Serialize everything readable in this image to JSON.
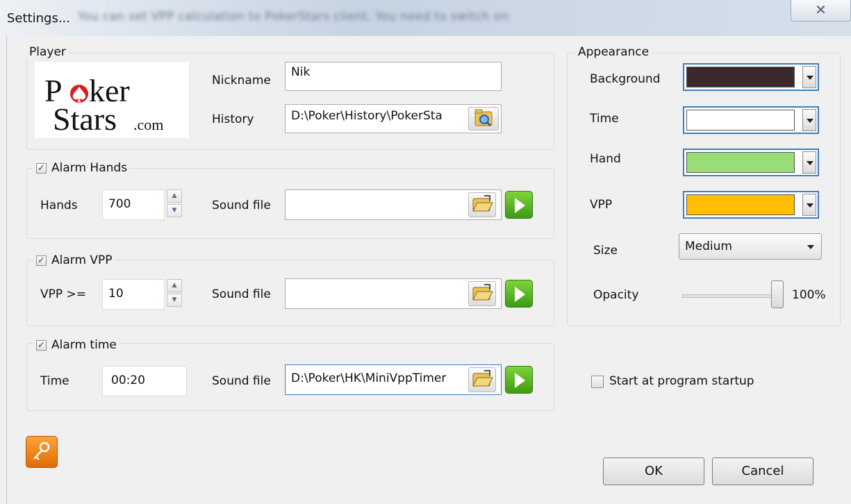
{
  "window": {
    "title": "Settings...",
    "background_text": "You can set VPP calculation to PokerStars client. You need to switch on",
    "close_glyph": "✕"
  },
  "logo": {
    "brand": "PokerStars.com",
    "line1_a": "P",
    "line1_b": "ker",
    "line2_a": "Stars",
    "line2_b": ".com"
  },
  "player": {
    "legend": "Player",
    "nickname_label": "Nickname",
    "nickname_value": "Nik",
    "history_label": "History",
    "history_value": "D:\\Poker\\History\\PokerSta"
  },
  "alarm_hands": {
    "legend": "Alarm Hands",
    "checked": true,
    "hands_label": "Hands",
    "hands_value": "700",
    "sound_label": "Sound file",
    "sound_value": ""
  },
  "alarm_vpp": {
    "legend": "Alarm VPP",
    "checked": true,
    "vpp_label": "VPP >=",
    "vpp_value": "10",
    "sound_label": "Sound file",
    "sound_value": ""
  },
  "alarm_time": {
    "legend": "Alarm time",
    "checked": true,
    "time_label": "Time",
    "time_value": "00:20",
    "sound_label": "Sound file",
    "sound_value": "D:\\Poker\\HK\\MiniVppTimer"
  },
  "appearance": {
    "legend": "Appearance",
    "background_label": "Background",
    "background_color": "#3a2a30",
    "time_label": "Time",
    "time_color": "#ffffff",
    "hand_label": "Hand",
    "hand_color": "#99dd77",
    "vpp_label": "VPP",
    "vpp_color": "#ffbf00",
    "size_label": "Size",
    "size_value": "Medium",
    "opacity_label": "Opacity",
    "opacity_value": "100%",
    "opacity_level": 1.0
  },
  "startup": {
    "label": "Start at program startup",
    "checked": false
  },
  "buttons": {
    "ok": "OK",
    "cancel": "Cancel"
  },
  "icons": {
    "key": "key-icon",
    "folder": "folder-open-icon",
    "folder_search": "folder-search-icon",
    "play": "play-icon",
    "check": "✓"
  },
  "colors": {
    "group_border": "#d5dbe2",
    "focus_border": "#3d7bc6",
    "key_button": "#f08a1c",
    "play_green": "#4aa81a"
  }
}
